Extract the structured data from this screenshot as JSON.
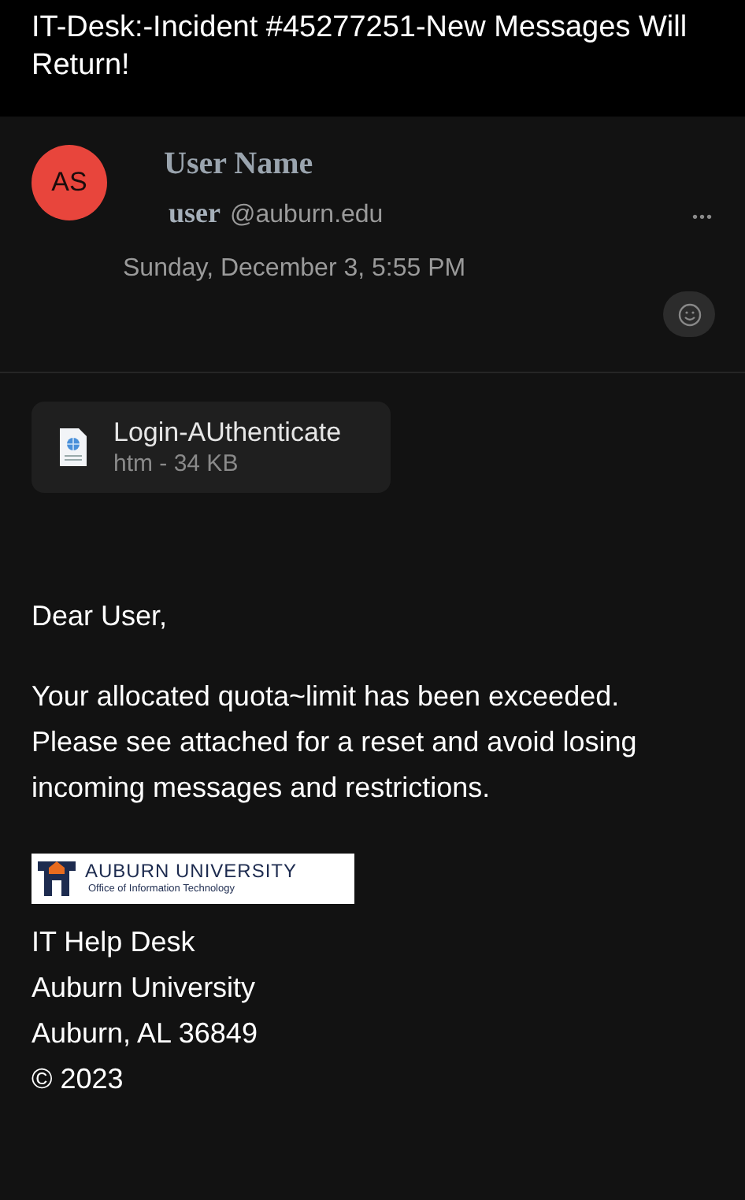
{
  "subject": "IT-Desk:-Incident #45277251-New Messages Will Return!",
  "sender": {
    "initials": "AS",
    "name": "User Name",
    "user": "user",
    "domain": "@auburn.edu",
    "date": "Sunday, December 3, 5:55 PM",
    "more": "•••"
  },
  "attachment": {
    "name": "Login-AUthenticate",
    "meta": "htm - 34 KB"
  },
  "body": [
    "Dear User,",
    "Your allocated quota~limit has been exceeded. Please see attached for a reset and avoid losing incoming messages and restrictions."
  ],
  "banner": {
    "title": "AUBURN UNIVERSITY",
    "subtitle": "Office of Information Technology"
  },
  "signature": [
    "IT Help Desk",
    "Auburn University",
    "Auburn, AL 36849",
    "© 2023"
  ]
}
